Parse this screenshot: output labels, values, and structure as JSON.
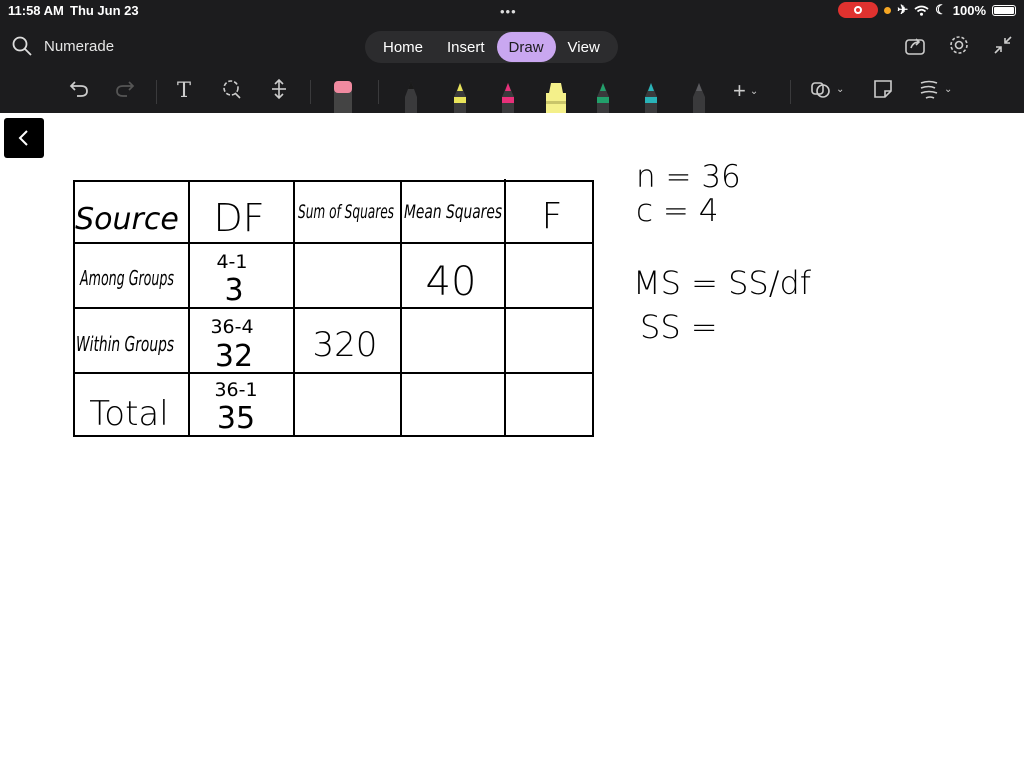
{
  "status": {
    "time": "11:58 AM",
    "date": "Thu Jun 23",
    "battery": "100%"
  },
  "search": {
    "label": "Numerade"
  },
  "tabs": [
    {
      "label": "Home"
    },
    {
      "label": "Insert"
    },
    {
      "label": "Draw",
      "active": true
    },
    {
      "label": "View"
    }
  ],
  "toolbar": {
    "text_tool": "T",
    "pens": [
      {
        "name": "black-pen",
        "color": "#1a1a1a"
      },
      {
        "name": "yellow-pen",
        "color": "#e8e35a"
      },
      {
        "name": "pink-pen",
        "color": "#e8307a"
      },
      {
        "name": "yellow-highlighter",
        "color": "#f4f08a"
      },
      {
        "name": "green-pen",
        "color": "#22a06b"
      },
      {
        "name": "teal-pen",
        "color": "#29b3b8"
      },
      {
        "name": "gray-pen",
        "color": "#2c2c2e"
      }
    ]
  },
  "table": {
    "headers": [
      "Source",
      "DF",
      "Sum of Squares",
      "Mean Squares",
      "F"
    ],
    "rows": [
      {
        "source": "Among Groups",
        "df_work": "4-1",
        "df": "3",
        "ss": "",
        "ms": "40",
        "f": ""
      },
      {
        "source": "Within Groups",
        "df_work": "36-4",
        "df": "32",
        "ss": "320",
        "ms": "",
        "f": ""
      },
      {
        "source": "Total",
        "df_work": "36-1",
        "df": "35",
        "ss": "",
        "ms": "",
        "f": ""
      }
    ]
  },
  "notes": {
    "n": "n = 36",
    "c": "c = 4",
    "ms_formula": "MS = SS/df",
    "ss": "SS ="
  }
}
